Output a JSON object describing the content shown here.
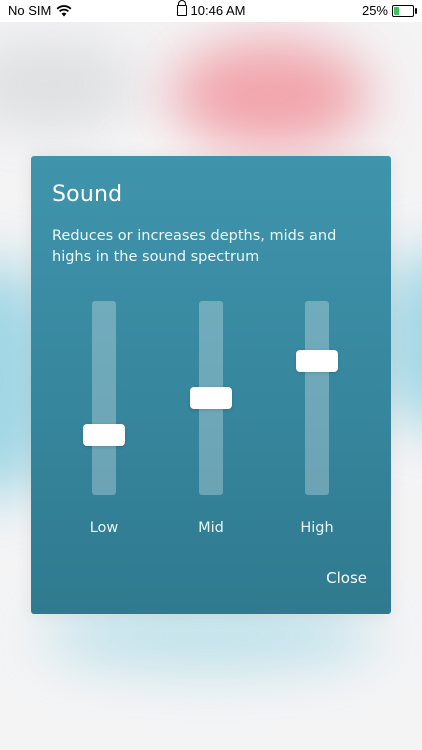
{
  "status_bar": {
    "carrier": "No SIM",
    "time": "10:46 AM",
    "battery_percent": "25%",
    "icons": [
      "wifi-icon",
      "lock-icon",
      "battery-charging-icon"
    ]
  },
  "dialog": {
    "title": "Sound",
    "description": "Reduces or increases depths, mids and highs in the sound spectrum",
    "close_label": "Close",
    "accent_color": "#3a8ea6",
    "sliders": [
      {
        "label": "Low",
        "level": 0.25
      },
      {
        "label": "Mid",
        "level": 0.5
      },
      {
        "label": "High",
        "level": 0.75
      }
    ]
  }
}
